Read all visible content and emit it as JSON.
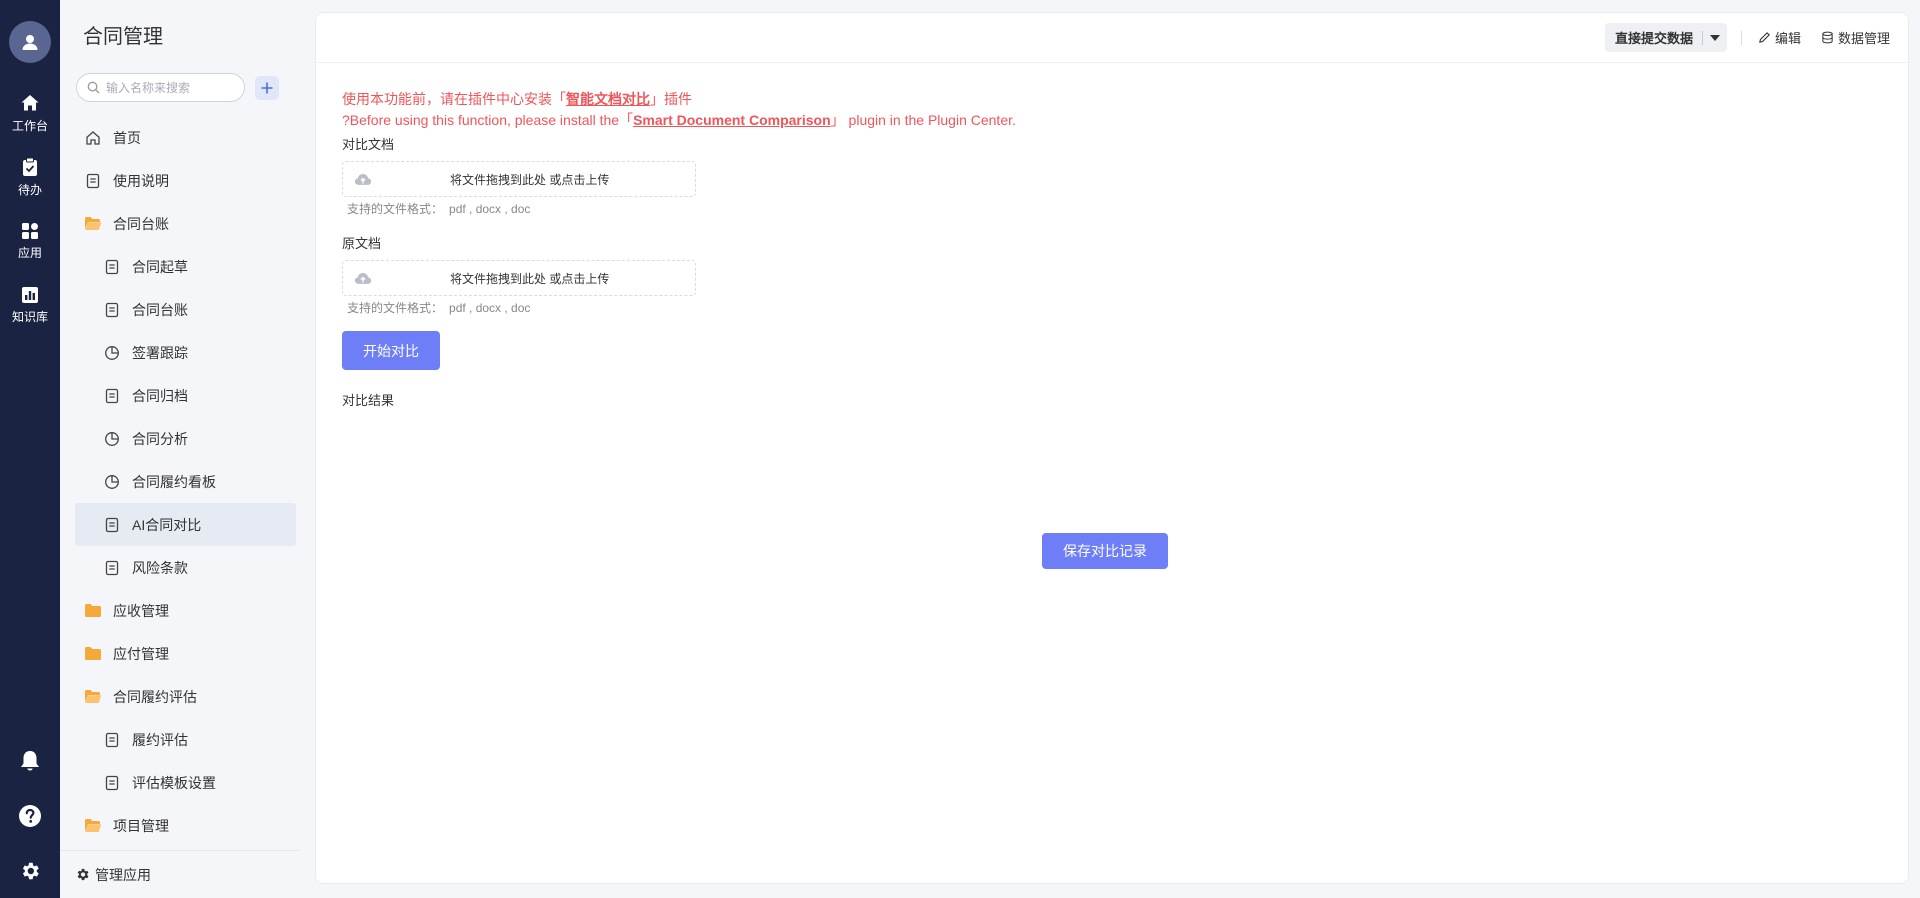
{
  "rail": {
    "items": [
      {
        "label": "工作台",
        "icon": "home-icon"
      },
      {
        "label": "待办",
        "icon": "clipboard-icon"
      },
      {
        "label": "应用",
        "icon": "apps-icon"
      },
      {
        "label": "知识库",
        "icon": "knowledge-icon"
      }
    ],
    "bottom": [
      "bell-icon",
      "help-icon",
      "settings-icon"
    ]
  },
  "sidebar": {
    "title": "合同管理",
    "search_placeholder": "输入名称来搜索",
    "items": [
      {
        "label": "首页",
        "icon": "home-outline-icon",
        "child": false
      },
      {
        "label": "使用说明",
        "icon": "doc-icon",
        "child": false
      },
      {
        "label": "合同台账",
        "icon": "folder-open-icon",
        "child": false
      },
      {
        "label": "合同起草",
        "icon": "doc-icon",
        "child": true
      },
      {
        "label": "合同台账",
        "icon": "doc-icon",
        "child": true
      },
      {
        "label": "签署跟踪",
        "icon": "pie-chart-icon",
        "child": true
      },
      {
        "label": "合同归档",
        "icon": "doc-icon",
        "child": true
      },
      {
        "label": "合同分析",
        "icon": "pie-chart-icon",
        "child": true
      },
      {
        "label": "合同履约看板",
        "icon": "pie-chart-icon",
        "child": true
      },
      {
        "label": "AI合同对比",
        "icon": "doc-icon",
        "child": true,
        "active": true
      },
      {
        "label": "风险条款",
        "icon": "doc-icon",
        "child": true
      },
      {
        "label": "应收管理",
        "icon": "folder-icon",
        "child": false
      },
      {
        "label": "应付管理",
        "icon": "folder-icon",
        "child": false
      },
      {
        "label": "合同履约评估",
        "icon": "folder-open-icon",
        "child": false
      },
      {
        "label": "履约评估",
        "icon": "doc-icon",
        "child": true
      },
      {
        "label": "评估模板设置",
        "icon": "doc-icon",
        "child": true
      },
      {
        "label": "项目管理",
        "icon": "folder-open-icon",
        "child": false
      }
    ],
    "footer_label": "管理应用"
  },
  "topbar": {
    "submit_label": "直接提交数据",
    "edit_label": "编辑",
    "data_label": "数据管理"
  },
  "content": {
    "notice_cn_prefix": "使用本功能前，请在插件中心安装「",
    "notice_cn_link": "智能文档对比",
    "notice_cn_suffix": "」插件",
    "notice_en_prefix": "?Before using this function, please install the「",
    "notice_en_link": "Smart Document Comparison",
    "notice_en_suffix": "」 plugin in the Plugin Center.",
    "compare_label": "对比文档",
    "original_label": "原文档",
    "upload_text": "将文件拖拽到此处 或点击上传",
    "formats_label": "支持的文件格式：",
    "formats_value": "pdf , docx , doc",
    "start_label": "开始对比",
    "result_label": "对比结果",
    "save_label": "保存对比记录"
  },
  "colors": {
    "rail_bg": "#1b2342",
    "primary": "#6d7ef6",
    "notice": "#f0555a",
    "folder": "#f6a93b"
  }
}
